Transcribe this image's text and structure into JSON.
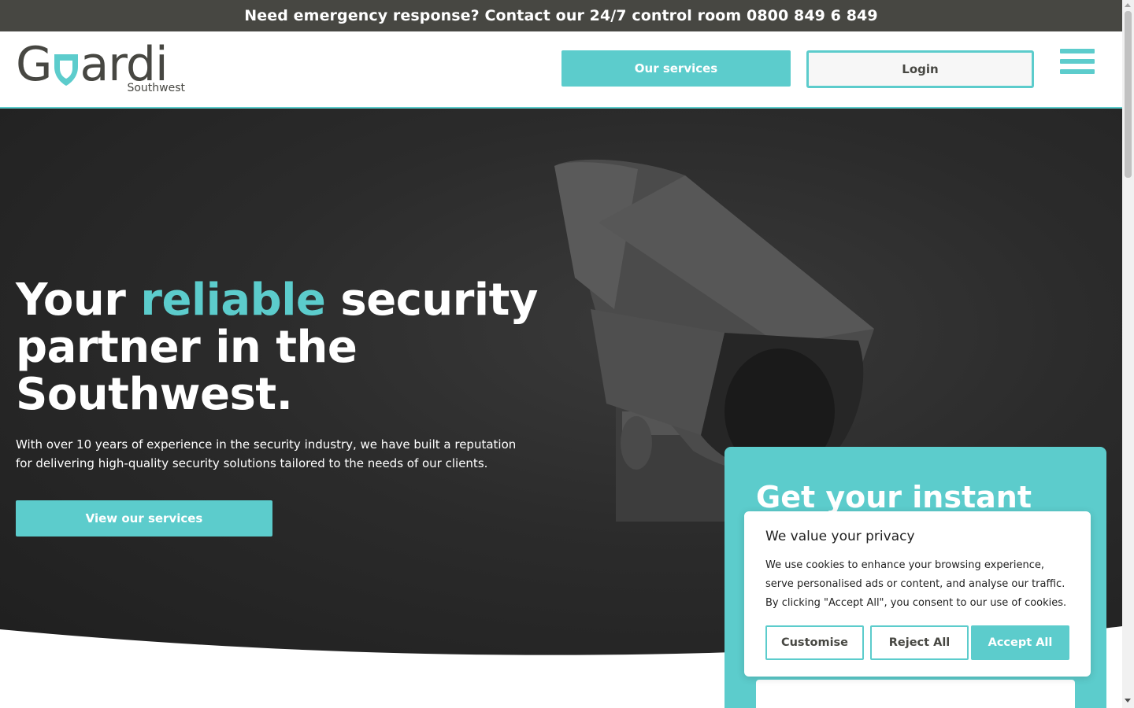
{
  "topbar": {
    "text": "Need emergency response? Contact our 24/7 control room 0800 849 6 849"
  },
  "logo": {
    "word_left": "G",
    "word_right": "ardi",
    "subtitle": "Southwest"
  },
  "header": {
    "services_label": "Our services",
    "login_label": "Login"
  },
  "hero": {
    "title_part1": "Your ",
    "title_accent": "reliable",
    "title_part2": " security partner in the Southwest.",
    "body": "With over 10 years of experience in the security industry, we have built a reputation for delivering high-quality security solutions tailored to the needs of our clients.",
    "cta_label": "View our services"
  },
  "quote_card": {
    "title": "Get your instant"
  },
  "cookie": {
    "title": "We value your privacy",
    "text": "We use cookies to enhance your browsing experience, serve personalised ads or content, and analyse our traffic. By clicking \"Accept All\", you consent to our use of cookies.",
    "customise_label": "Customise",
    "reject_label": "Reject All",
    "accept_label": "Accept All"
  },
  "colors": {
    "accent": "#5ccccc",
    "dark": "#474742",
    "hero_bg": "#2b2b2b"
  },
  "icons": {
    "menu": "hamburger-menu-icon",
    "logo_shield": "shield-icon"
  }
}
